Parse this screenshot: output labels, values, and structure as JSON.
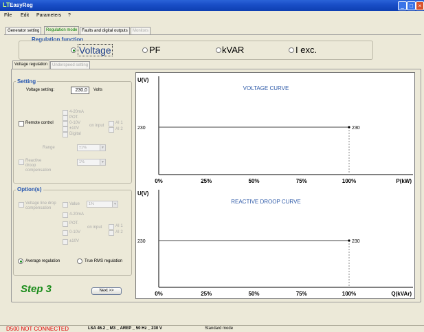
{
  "window": {
    "title": "EasyReg",
    "logo": "LT"
  },
  "menu": [
    "File",
    "Edit",
    "Parameters",
    "?"
  ],
  "main_tabs": [
    {
      "label": "Generator setting"
    },
    {
      "label": "Regulation mode"
    },
    {
      "label": "Faults and digital outputs"
    },
    {
      "label": "Monitors"
    }
  ],
  "regulation_function": {
    "title": "Regulation function",
    "options": [
      {
        "label": "Voltage",
        "selected": true
      },
      {
        "label": "PF",
        "selected": false
      },
      {
        "label": "kVAR",
        "selected": false
      },
      {
        "label": "I exc.",
        "selected": false
      }
    ]
  },
  "sub_tabs": [
    {
      "label": "Voltage regulation"
    },
    {
      "label": "Underspeed setting"
    }
  ],
  "setting": {
    "title": "Setting",
    "voltage_label": "Voltage setting:",
    "voltage_value": "230,0",
    "voltage_unit": "Volts",
    "remote_control": "Remote control",
    "inputs": [
      "4-20mA",
      "POT.",
      "0-10V",
      "±10V",
      "Digital"
    ],
    "on_input": "on input",
    "ai": [
      "AI 1",
      "AI 2"
    ],
    "range_label": "Range",
    "range_value": "±1%",
    "reactive_droop": "Reactive droop compensation",
    "reactive_value": "1%"
  },
  "options": {
    "title": "Option(s)",
    "voltage_line_drop": "Voltage line drop compensation",
    "value_label": "Value",
    "value_combo": "1%",
    "inputs": [
      "4-20mA",
      "POT.",
      "0-10V",
      "±10V"
    ],
    "on_input": "on input",
    "ai": [
      "AI 1",
      "AI 2"
    ],
    "average_regulation": "Average regulation",
    "true_rms": "True RMS regulation"
  },
  "step": "Step 3",
  "next_button": "Next >>",
  "status": {
    "connection": "D500 NOT CONNECTED",
    "info": "LSA 46.2 _ M3 _ AREP _ 50 Hz _ 230 V",
    "mode": "Standard mode"
  },
  "colors": {
    "accent_green": "#1a8c1a",
    "chart_title": "#2e5aa8",
    "status_red": "#e00000"
  },
  "chart_data": [
    {
      "type": "line",
      "title": "VOLTAGE CURVE",
      "ylabel": "U(V)",
      "xlabel": "P(kW)",
      "x_ticks": [
        "0%",
        "25%",
        "50%",
        "75%",
        "100%"
      ],
      "x": [
        0,
        100
      ],
      "values": [
        230,
        230
      ],
      "ylabel_value": "230",
      "point_label": "230",
      "marker_x": 100,
      "xlim": [
        0,
        120
      ]
    },
    {
      "type": "line",
      "title": "REACTIVE DROOP CURVE",
      "ylabel": "U(V)",
      "xlabel": "Q(kVAr)",
      "x_ticks": [
        "0%",
        "25%",
        "50%",
        "75%",
        "100%"
      ],
      "x": [
        0,
        100
      ],
      "values": [
        230,
        230
      ],
      "ylabel_value": "230",
      "point_label": "230",
      "marker_x": 100,
      "xlim": [
        0,
        120
      ]
    }
  ]
}
